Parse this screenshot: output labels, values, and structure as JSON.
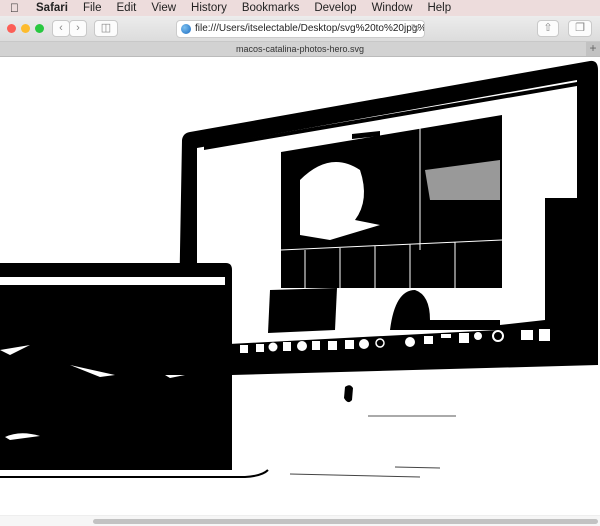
{
  "menubar": {
    "apple": "",
    "items": [
      "Safari",
      "File",
      "Edit",
      "View",
      "History",
      "Bookmarks",
      "Develop",
      "Window",
      "Help"
    ]
  },
  "toolbar": {
    "back_icon": "chevron-left-icon",
    "forward_icon": "chevron-right-icon",
    "sidebar_icon": "sidebar-icon",
    "url": "file:///Users/itselectable/Desktop/svg%20to%20jpg%2",
    "share_icon": "share-icon",
    "tabs_icon": "tabs-overview-icon",
    "traffic_lights": [
      "#fc5f57",
      "#fdbc2e",
      "#28c840"
    ]
  },
  "tab": {
    "title": "macos-catalina-photos-hero.svg",
    "new_tab": "+"
  }
}
